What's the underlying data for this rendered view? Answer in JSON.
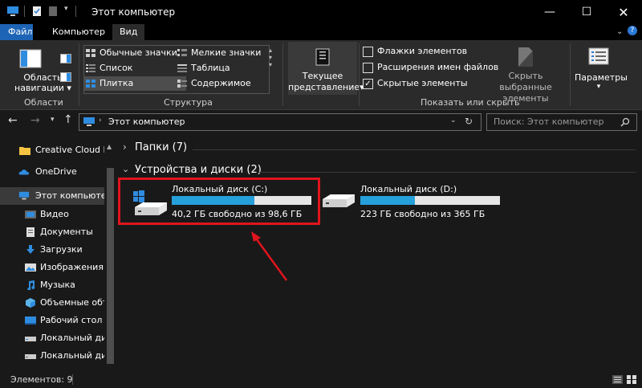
{
  "window": {
    "title": "Этот компьютер"
  },
  "menu_tabs": [
    "Файл",
    "Компьютер",
    "Вид"
  ],
  "ribbon": {
    "panes": {
      "nav_pane_label_1": "Область",
      "nav_pane_label_2": "навигации",
      "group_label": "Области"
    },
    "layout": {
      "items": [
        "Обычные значки",
        "Мелкие значки",
        "Список",
        "Таблица",
        "Плитка",
        "Содержимое"
      ],
      "selected": "Плитка",
      "group_label": "Структура"
    },
    "current_view": {
      "label_1": "Текущее",
      "label_2": "представление"
    },
    "show_hide": {
      "checkboxes": [
        {
          "label": "Флажки элементов",
          "checked": false
        },
        {
          "label": "Расширения имен файлов",
          "checked": false
        },
        {
          "label": "Скрытые элементы",
          "checked": true
        }
      ],
      "hide_selected_1": "Скрыть выбранные",
      "hide_selected_2": "элементы",
      "group_label": "Показать или скрыть"
    },
    "options": {
      "label": "Параметры"
    }
  },
  "address": {
    "path": "Этот компьютер",
    "search_placeholder": "Поиск: Этот компьютер"
  },
  "sidebar": {
    "items": [
      {
        "label": "Creative Cloud Fil",
        "icon": "folder-icon"
      },
      {
        "label": "OneDrive",
        "icon": "cloud-icon"
      },
      {
        "label": "Этот компьютер",
        "icon": "computer-icon",
        "selected": true
      },
      {
        "label": "Видео",
        "icon": "video-icon"
      },
      {
        "label": "Документы",
        "icon": "documents-icon"
      },
      {
        "label": "Загрузки",
        "icon": "download-icon"
      },
      {
        "label": "Изображения",
        "icon": "pictures-icon"
      },
      {
        "label": "Музыка",
        "icon": "music-icon"
      },
      {
        "label": "Объемные объ",
        "icon": "3d-objects-icon"
      },
      {
        "label": "Рабочий стол",
        "icon": "desktop-icon"
      },
      {
        "label": "Локальный дис",
        "icon": "drive-icon"
      },
      {
        "label": "Локальный дис",
        "icon": "drive-icon"
      }
    ]
  },
  "content": {
    "folders_group": "Папки (7)",
    "devices_group": "Устройства и диски (2)",
    "drives": [
      {
        "name": "Локальный диск (C:)",
        "free_text": "40,2 ГБ свободно из 98,6 ГБ",
        "used_fraction": 0.59
      },
      {
        "name": "Локальный диск (D:)",
        "free_text": "223 ГБ свободно из 365 ГБ",
        "used_fraction": 0.39
      }
    ]
  },
  "status": {
    "items_count": "Элементов: 9"
  },
  "colors": {
    "accent": "#1e64b6",
    "bar_fill": "#26a0da",
    "highlight": "#e0141d"
  }
}
